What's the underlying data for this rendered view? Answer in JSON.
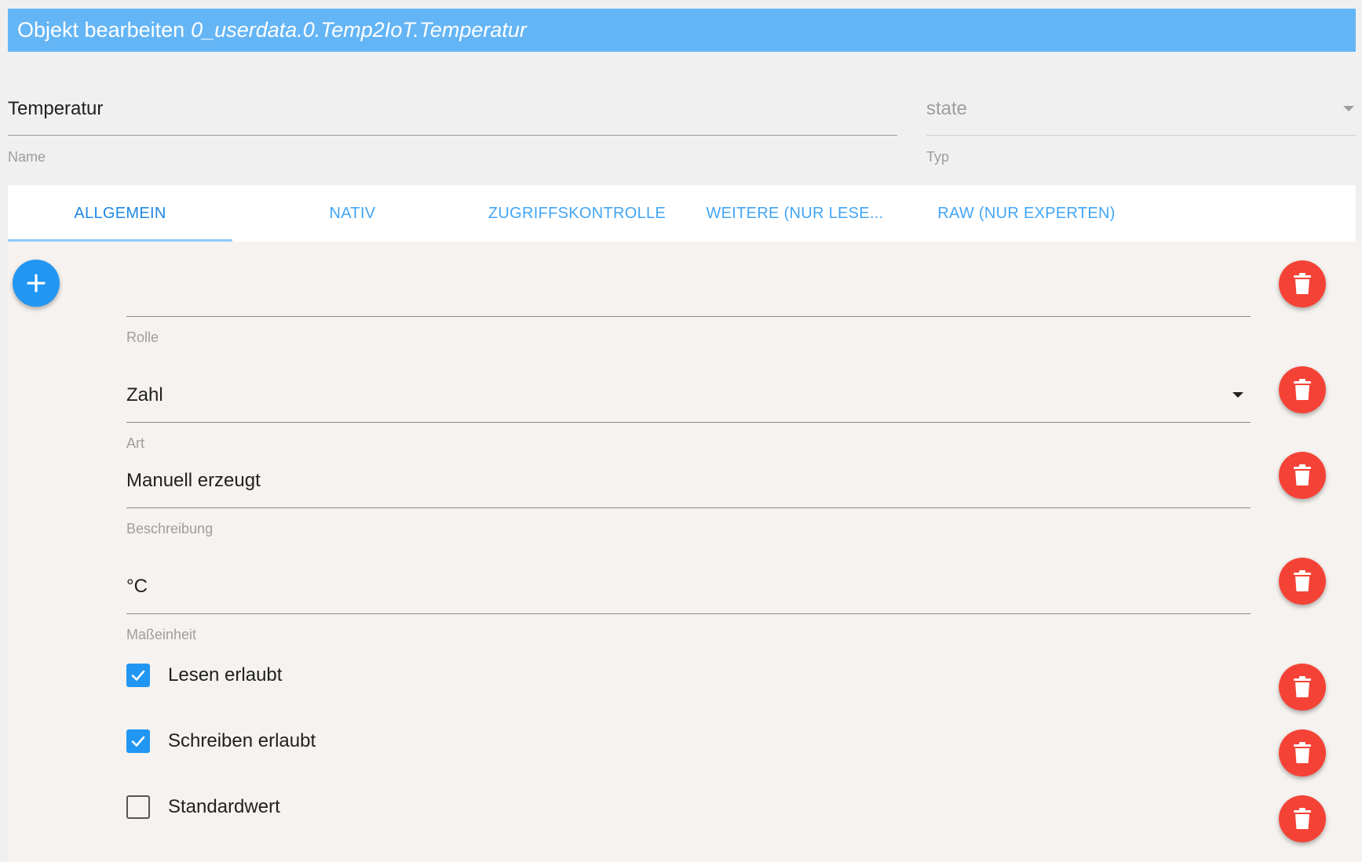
{
  "dialog": {
    "title_prefix": "Objekt bearbeiten",
    "object_id": "0_userdata.0.Temp2IoT.Temperatur"
  },
  "name_field": {
    "value": "Temperatur",
    "label": "Name"
  },
  "type_field": {
    "value": "state",
    "label": "Typ"
  },
  "tabs": [
    {
      "label": "ALLGEMEIN",
      "active": true
    },
    {
      "label": "NATIV",
      "active": false
    },
    {
      "label": "ZUGRIFFSKONTROLLE",
      "active": false
    },
    {
      "label": "WEITERE (NUR LESE...",
      "active": false
    },
    {
      "label": "RAW (NUR EXPERTEN)",
      "active": false
    }
  ],
  "fields": {
    "role": {
      "value": "",
      "label": "Rolle"
    },
    "art": {
      "value": "Zahl",
      "label": "Art"
    },
    "description": {
      "value": "Manuell erzeugt",
      "label": "Beschreibung"
    },
    "unit": {
      "value": "°C",
      "label": "Maßeinheit"
    }
  },
  "checkboxes": {
    "read": {
      "label": "Lesen erlaubt",
      "checked": true
    },
    "write": {
      "label": "Schreiben erlaubt",
      "checked": true
    },
    "default": {
      "label": "Standardwert",
      "checked": false
    }
  },
  "icons": {
    "add": "plus-icon",
    "delete": "trash-icon",
    "dropdown": "caret-down-icon",
    "check": "check-icon"
  },
  "colors": {
    "header": "#64b5f6",
    "accent": "#2196f3",
    "danger": "#f44336",
    "tab_text": "#42a5f5"
  }
}
